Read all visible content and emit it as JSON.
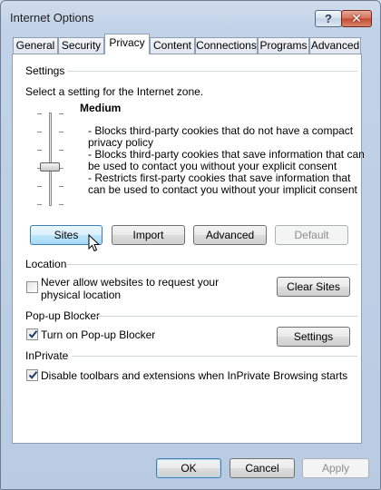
{
  "window": {
    "title": "Internet Options"
  },
  "title_buttons": {
    "help": "?",
    "close": "✕"
  },
  "tabs": [
    {
      "label": "General"
    },
    {
      "label": "Security"
    },
    {
      "label": "Privacy"
    },
    {
      "label": "Content"
    },
    {
      "label": "Connections"
    },
    {
      "label": "Programs"
    },
    {
      "label": "Advanced"
    }
  ],
  "settings": {
    "heading": "Settings",
    "intro": "Select a setting for the Internet zone.",
    "level_name": "Medium",
    "bullets": [
      [
        "- Blocks third-party cookies that do not have a compact",
        "privacy policy"
      ],
      [
        "- Blocks third-party cookies that save information that can",
        "be used to contact you without your explicit consent"
      ],
      [
        "- Restricts first-party cookies that save information that",
        "can be used to contact you without your implicit consent"
      ]
    ],
    "buttons": {
      "sites": "Sites",
      "import": "Import",
      "advanced": "Advanced",
      "default": "Default"
    }
  },
  "location": {
    "heading": "Location",
    "checkbox_line1": "Never allow websites to request your",
    "checkbox_line2": "physical location",
    "checked": false,
    "clear_sites": "Clear Sites"
  },
  "popup": {
    "heading": "Pop-up Blocker",
    "checkbox_label": "Turn on Pop-up Blocker",
    "checked": true,
    "settings": "Settings"
  },
  "inprivate": {
    "heading": "InPrivate",
    "checkbox_label": "Disable toolbars and extensions when InPrivate Browsing starts",
    "checked": true
  },
  "footer": {
    "ok": "OK",
    "cancel": "Cancel",
    "apply": "Apply"
  }
}
